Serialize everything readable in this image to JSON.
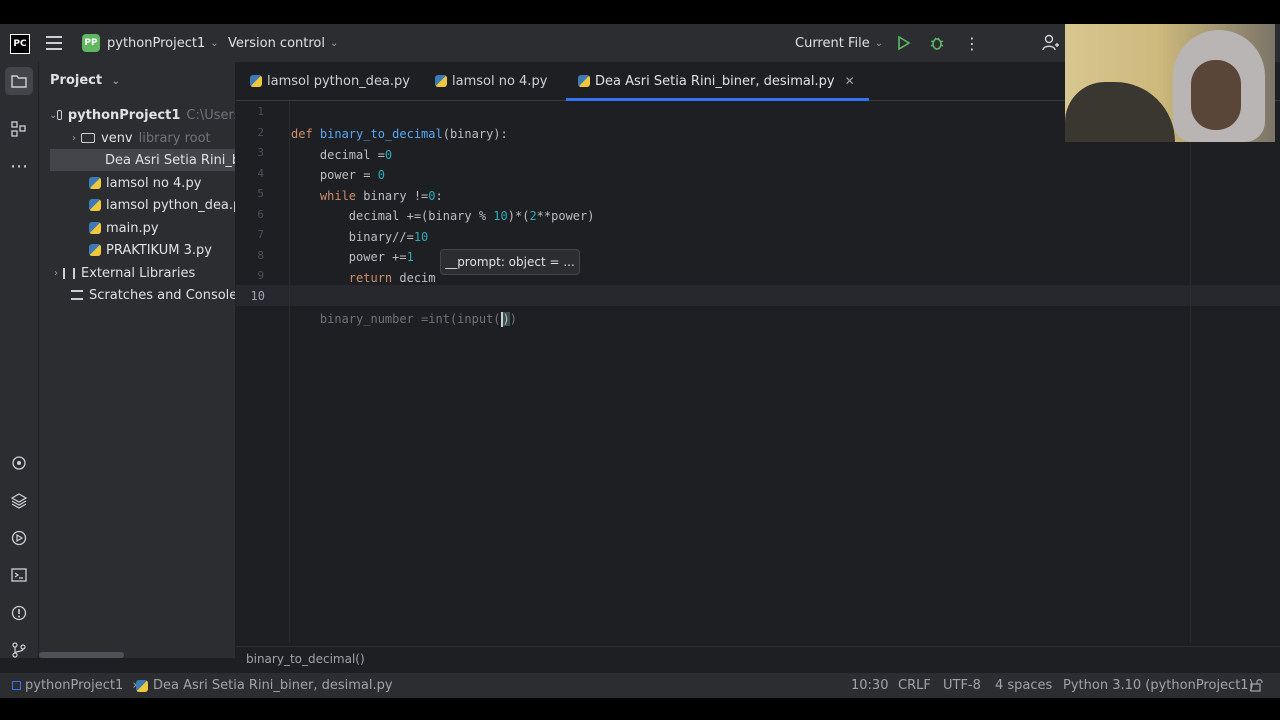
{
  "toolbar": {
    "logo_text": "PC",
    "project_badge": "PP",
    "project_name": "pythonProject1",
    "version_control": "Version control",
    "run_config": "Current File"
  },
  "project_panel": {
    "title": "Project",
    "tree": [
      {
        "label": "pythonProject1",
        "hint": "C:\\Users\\",
        "type": "folder",
        "expanded": true
      },
      {
        "label": "venv",
        "hint": "library root",
        "type": "folder",
        "expanded": false
      },
      {
        "label": "Dea Asri Setia Rini_biner, desimal.py",
        "type": "py",
        "selected": true
      },
      {
        "label": "lamsol no 4.py",
        "type": "py"
      },
      {
        "label": "lamsol python_dea.py",
        "type": "py"
      },
      {
        "label": "main.py",
        "type": "py"
      },
      {
        "label": "PRAKTIKUM 3.py",
        "type": "py"
      },
      {
        "label": "External Libraries",
        "type": "lib"
      },
      {
        "label": "Scratches and Consoles",
        "type": "scratch"
      }
    ]
  },
  "tabs": [
    {
      "label": "lamsol python_dea.py",
      "active": false
    },
    {
      "label": "lamsol no 4.py",
      "active": false
    },
    {
      "label": "Dea Asri Setia Rini_biner, desimal.py",
      "active": true
    }
  ],
  "editor": {
    "line_numbers": [
      "1",
      "2",
      "3",
      "4",
      "5",
      "6",
      "7",
      "8",
      "9",
      "10"
    ],
    "code": {
      "l1_kw": "def ",
      "l1_fn": "binary_to_decimal",
      "l1_rest": "(binary):",
      "l2_a": "    decimal =",
      "l2_n": "0",
      "l3_a": "    power = ",
      "l3_n": "0",
      "l4_kw": "    while ",
      "l4_a": "binary !=",
      "l4_n": "0",
      "l4_b": ":",
      "l5_a": "        decimal +=(binary % ",
      "l5_n1": "10",
      "l5_b": ")*(",
      "l5_n2": "2",
      "l5_c": "**power)",
      "l6_a": "        binary//=",
      "l6_n": "10",
      "l7_a": "        power +=",
      "l7_n": "1",
      "l8_kw": "        return ",
      "l8_a": "decim",
      "l10_a": "    binary_number ",
      "l10_b": "=int(input(",
      "l10_c": ")",
      "l10_d": ")"
    },
    "tooltip": "__prompt: object = ...",
    "breadcrumb": "binary_to_decimal()"
  },
  "status_bar": {
    "project": "pythonProject1",
    "file": "Dea Asri Setia Rini_biner, desimal.py",
    "position": "10:30",
    "line_sep": "CRLF",
    "encoding": "UTF-8",
    "indent": "4 spaces",
    "interpreter": "Python 3.10 (pythonProject1)"
  }
}
